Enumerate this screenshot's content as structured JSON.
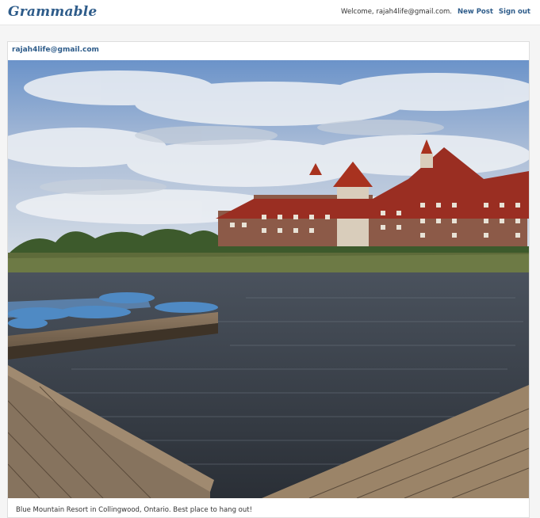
{
  "navbar": {
    "brand": "Grammable",
    "welcome": "Welcome, rajah4life@gmail.com.",
    "new_post": "New Post",
    "sign_out": "Sign out"
  },
  "post": {
    "author": "rajah4life@gmail.com",
    "caption": "Blue Mountain Resort in Collingwood, Ontario. Best place to hang out!"
  },
  "colors": {
    "brand": "#2e5c8a",
    "page_bg": "#f5f5f5"
  }
}
